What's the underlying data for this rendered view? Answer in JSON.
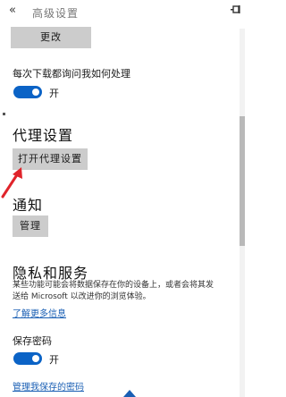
{
  "header": {
    "back_label": "«",
    "title": "高级设置"
  },
  "change_button": "更改",
  "download": {
    "label": "每次下载都询问我如何处理",
    "toggle_state": "开"
  },
  "proxy": {
    "heading": "代理设置",
    "button": "打开代理设置"
  },
  "notifications": {
    "heading": "通知",
    "button": "管理"
  },
  "privacy": {
    "heading": "隐私和服务",
    "description_line1": "某些功能可能会将数据保存在你的设备上，或者会将其发",
    "description_line2": "送给 Microsoft 以改进你的浏览体验。",
    "learn_more": "了解更多信息"
  },
  "passwords": {
    "label": "保存密码",
    "toggle_state": "开",
    "manage_link": "管理我保存的密码"
  },
  "colors": {
    "accent": "#0b63c6",
    "button_bg": "#cccccc",
    "link": "#1a5fb4",
    "arrow": "#e0242b"
  }
}
